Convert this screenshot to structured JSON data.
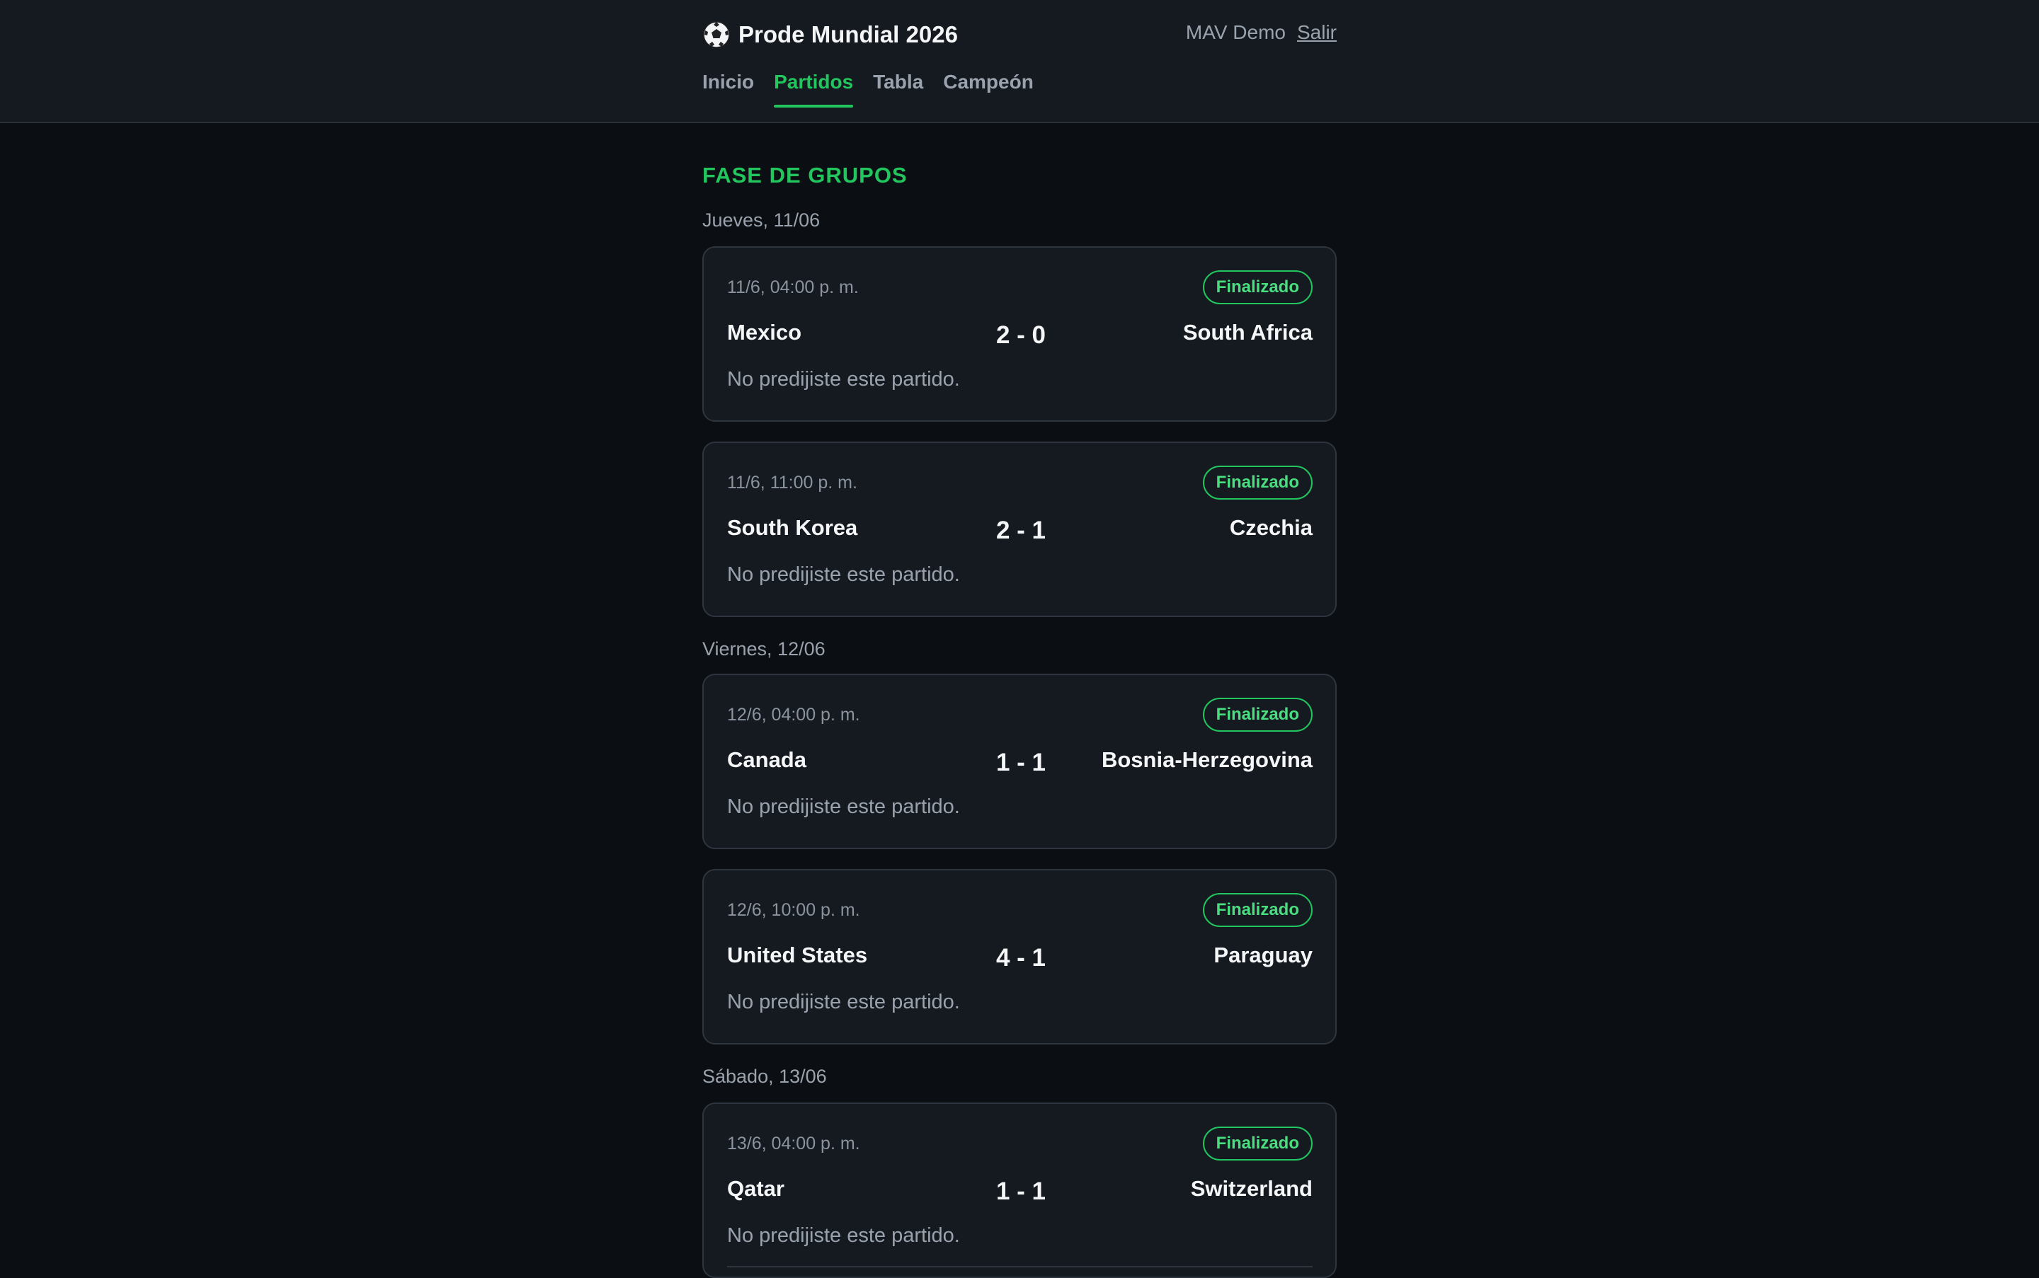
{
  "header": {
    "brand_title": "Prode Mundial 2026",
    "user_name": "MAV Demo",
    "logout_label": "Salir",
    "nav": [
      {
        "label": "Inicio",
        "active": false
      },
      {
        "label": "Partidos",
        "active": true
      },
      {
        "label": "Tabla",
        "active": false
      },
      {
        "label": "Campeón",
        "active": false
      }
    ]
  },
  "main": {
    "phase_title": "FASE DE GRUPOS",
    "days": [
      {
        "label": "Jueves, 11/06"
      },
      {
        "label": "Viernes, 12/06"
      },
      {
        "label": "Sábado, 13/06"
      }
    ],
    "matches": [
      {
        "time": "11/6, 04:00 p. m.",
        "status": "Finalizado",
        "home": "Mexico",
        "score": "2 - 0",
        "away": "South Africa",
        "note": "No predijiste este partido."
      },
      {
        "time": "11/6, 11:00 p. m.",
        "status": "Finalizado",
        "home": "South Korea",
        "score": "2 - 1",
        "away": "Czechia",
        "note": "No predijiste este partido."
      },
      {
        "time": "12/6, 04:00 p. m.",
        "status": "Finalizado",
        "home": "Canada",
        "score": "1 - 1",
        "away": "Bosnia-Herzegovina",
        "note": "No predijiste este partido."
      },
      {
        "time": "12/6, 10:00 p. m.",
        "status": "Finalizado",
        "home": "United States",
        "score": "4 - 1",
        "away": "Paraguay",
        "note": "No predijiste este partido."
      },
      {
        "time": "13/6, 04:00 p. m.",
        "status": "Finalizado",
        "home": "Qatar",
        "score": "1 - 1",
        "away": "Switzerland",
        "note": "No predijiste este partido."
      }
    ]
  },
  "colors": {
    "accent": "#22c55e",
    "background": "#0b0e13",
    "surface": "#151a21",
    "muted_text": "#9aa3ad"
  },
  "icons": {
    "brand": "soccer-ball-icon"
  }
}
